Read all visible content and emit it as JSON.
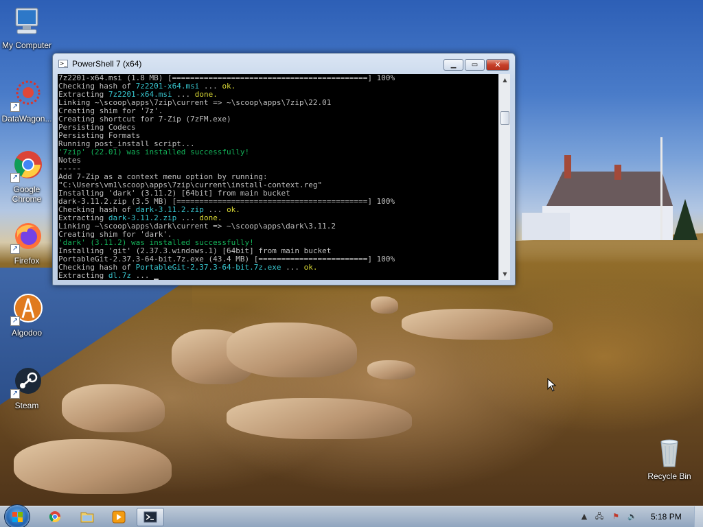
{
  "desktop": {
    "icons": [
      {
        "label": "My Computer",
        "icon": "computer-icon"
      },
      {
        "label": "DataWagon...",
        "icon": "datawagon-icon"
      },
      {
        "label": "Google Chrome",
        "icon": "chrome-icon"
      },
      {
        "label": "Firefox",
        "icon": "firefox-icon"
      },
      {
        "label": "Algodoo",
        "icon": "algodoo-icon"
      },
      {
        "label": "Steam",
        "icon": "steam-icon"
      },
      {
        "label": "Recycle Bin",
        "icon": "recycle-bin-icon"
      }
    ],
    "shortcut_glyph": "↗"
  },
  "window": {
    "title": "PowerShell 7 (x64)",
    "minimize_glyph": "▁",
    "maximize_glyph": "▭",
    "close_glyph": "✕",
    "scroll_up_glyph": "▲",
    "scroll_down_glyph": "▼",
    "console_lines": [
      {
        "parts": [
          {
            "t": "7z2201-x64.msi (1.8 MB) [===========================================] 100%",
            "c": ""
          }
        ]
      },
      {
        "parts": [
          {
            "t": "Checking hash of ",
            "c": ""
          },
          {
            "t": "7z2201-x64.msi",
            "c": "cyan"
          },
          {
            "t": " ... ",
            "c": ""
          },
          {
            "t": "ok.",
            "c": "ok"
          }
        ]
      },
      {
        "parts": [
          {
            "t": "Extracting ",
            "c": ""
          },
          {
            "t": "7z2201-x64.msi",
            "c": "cyan"
          },
          {
            "t": " ... ",
            "c": ""
          },
          {
            "t": "done.",
            "c": "ok"
          }
        ]
      },
      {
        "parts": [
          {
            "t": "Linking ~\\scoop\\apps\\7zip\\current => ~\\scoop\\apps\\7zip\\22.01",
            "c": ""
          }
        ]
      },
      {
        "parts": [
          {
            "t": "Creating shim for '7z'.",
            "c": ""
          }
        ]
      },
      {
        "parts": [
          {
            "t": "Creating shortcut for 7-Zip (7zFM.exe)",
            "c": ""
          }
        ]
      },
      {
        "parts": [
          {
            "t": "Persisting Codecs",
            "c": ""
          }
        ]
      },
      {
        "parts": [
          {
            "t": "Persisting Formats",
            "c": ""
          }
        ]
      },
      {
        "parts": [
          {
            "t": "Running post_install script...",
            "c": ""
          }
        ]
      },
      {
        "parts": [
          {
            "t": "'7zip' (22.01) was installed successfully!",
            "c": "green"
          }
        ]
      },
      {
        "parts": [
          {
            "t": "Notes",
            "c": ""
          }
        ]
      },
      {
        "parts": [
          {
            "t": "-----",
            "c": ""
          }
        ]
      },
      {
        "parts": [
          {
            "t": "Add 7-Zip as a context menu option by running:",
            "c": ""
          }
        ]
      },
      {
        "parts": [
          {
            "t": "\"C:\\Users\\vm1\\scoop\\apps\\7zip\\current\\install-context.reg\"",
            "c": ""
          }
        ]
      },
      {
        "parts": [
          {
            "t": "Installing 'dark' (3.11.2) [64bit] from main bucket",
            "c": ""
          }
        ]
      },
      {
        "parts": [
          {
            "t": "dark-3.11.2.zip (3.5 MB) [==========================================] 100%",
            "c": ""
          }
        ]
      },
      {
        "parts": [
          {
            "t": "Checking hash of ",
            "c": ""
          },
          {
            "t": "dark-3.11.2.zip",
            "c": "cyan"
          },
          {
            "t": " ... ",
            "c": ""
          },
          {
            "t": "ok.",
            "c": "ok"
          }
        ]
      },
      {
        "parts": [
          {
            "t": "Extracting ",
            "c": ""
          },
          {
            "t": "dark-3.11.2.zip",
            "c": "cyan"
          },
          {
            "t": " ... ",
            "c": ""
          },
          {
            "t": "done.",
            "c": "ok"
          }
        ]
      },
      {
        "parts": [
          {
            "t": "Linking ~\\scoop\\apps\\dark\\current => ~\\scoop\\apps\\dark\\3.11.2",
            "c": ""
          }
        ]
      },
      {
        "parts": [
          {
            "t": "Creating shim for 'dark'.",
            "c": ""
          }
        ]
      },
      {
        "parts": [
          {
            "t": "'dark' (3.11.2) was installed successfully!",
            "c": "green"
          }
        ]
      },
      {
        "parts": [
          {
            "t": "Installing 'git' (2.37.3.windows.1) [64bit] from main bucket",
            "c": ""
          }
        ]
      },
      {
        "parts": [
          {
            "t": "PortableGit-2.37.3-64-bit.7z.exe (43.4 MB) [========================] 100%",
            "c": ""
          }
        ]
      },
      {
        "parts": [
          {
            "t": "Checking hash of ",
            "c": ""
          },
          {
            "t": "PortableGit-2.37.3-64-bit.7z.exe",
            "c": "cyan"
          },
          {
            "t": " ... ",
            "c": ""
          },
          {
            "t": "ok.",
            "c": "ok"
          }
        ]
      },
      {
        "parts": [
          {
            "t": "Extracting ",
            "c": ""
          },
          {
            "t": "dl.7z",
            "c": "cyan"
          },
          {
            "t": " ... ",
            "c": ""
          }
        ],
        "cursor": true
      }
    ]
  },
  "taskbar": {
    "pinned": [
      {
        "name": "taskbar-chrome-button",
        "icon": "chrome-icon"
      },
      {
        "name": "taskbar-explorer-button",
        "icon": "folder-icon"
      },
      {
        "name": "taskbar-media-player-button",
        "icon": "media-player-icon"
      },
      {
        "name": "taskbar-powershell-button",
        "icon": "powershell-icon",
        "active": true
      }
    ],
    "tray": {
      "show_hidden_glyph": "▲",
      "network_glyph": "🖧",
      "flag_glyph": "⚑",
      "volume_glyph": "🔊",
      "clock": "5:18 PM"
    }
  },
  "colors": {
    "console_bg": "#000000",
    "console_fg": "#c0c0c0",
    "hash_ok": "#d8d835",
    "filename": "#38c7d0",
    "success": "#14b45a",
    "close_button": "#c6402a"
  }
}
